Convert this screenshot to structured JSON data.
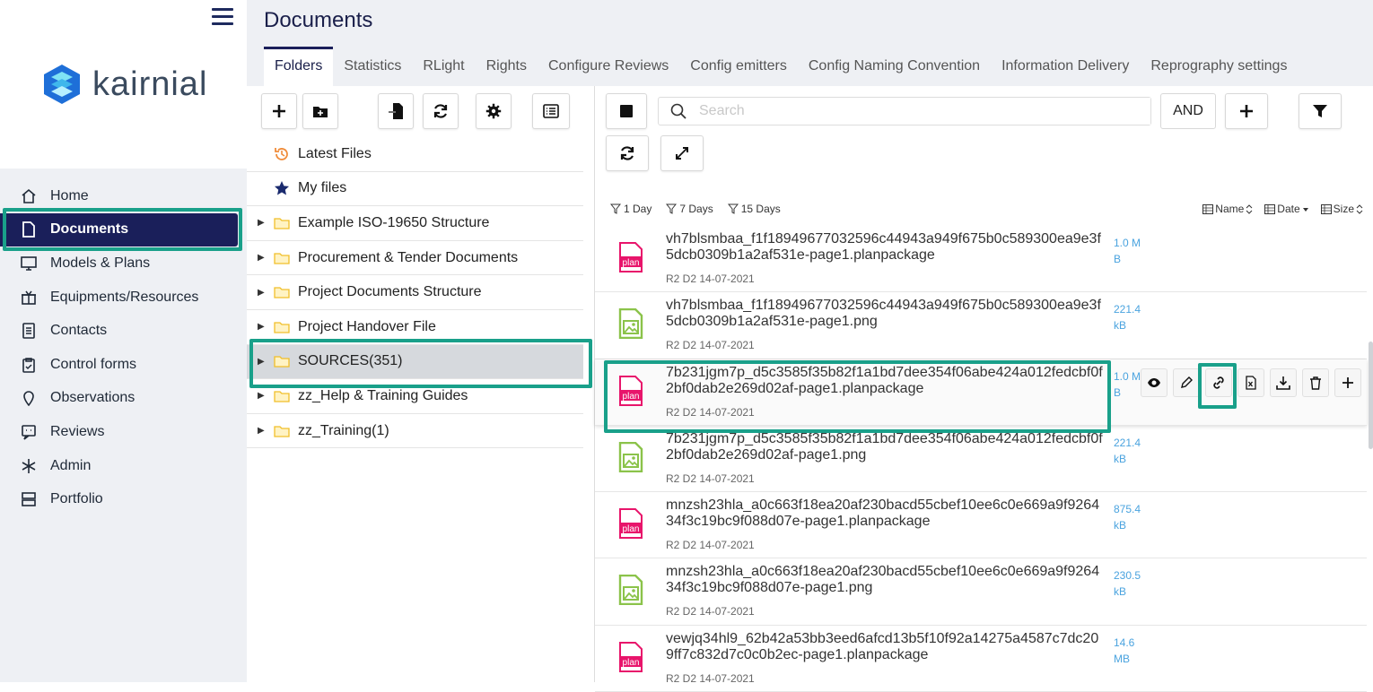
{
  "app": {
    "brand": "kairnial",
    "page_title": "Documents"
  },
  "nav": [
    {
      "label": "Home",
      "icon": "home-icon"
    },
    {
      "label": "Documents",
      "icon": "document-icon",
      "active": true
    },
    {
      "label": "Models & Plans",
      "icon": "monitor-icon"
    },
    {
      "label": "Equipments/Resources",
      "icon": "box-icon"
    },
    {
      "label": "Contacts",
      "icon": "contacts-icon"
    },
    {
      "label": "Control forms",
      "icon": "clipboard-check-icon"
    },
    {
      "label": "Observations",
      "icon": "map-pin-icon"
    },
    {
      "label": "Reviews",
      "icon": "review-icon"
    },
    {
      "label": "Admin",
      "icon": "asterisk-icon"
    },
    {
      "label": "Portfolio",
      "icon": "server-icon"
    }
  ],
  "tabs": [
    "Folders",
    "Statistics",
    "RLight",
    "Rights",
    "Configure Reviews",
    "Config emitters",
    "Config Naming Convention",
    "Information Delivery",
    "Reprography settings"
  ],
  "tree": [
    {
      "label": "Latest Files",
      "icon": "history-icon",
      "caret": false
    },
    {
      "label": "My files",
      "icon": "star-icon",
      "caret": false
    },
    {
      "label": "Example ISO-19650 Structure",
      "icon": "folder-icon",
      "caret": true
    },
    {
      "label": "Procurement & Tender Documents",
      "icon": "folder-icon",
      "caret": true
    },
    {
      "label": "Project Documents Structure",
      "icon": "folder-icon",
      "caret": true
    },
    {
      "label": "Project Handover File",
      "icon": "folder-icon",
      "caret": true
    },
    {
      "label": "SOURCES(351)",
      "icon": "folder-icon",
      "caret": true,
      "selected": true
    },
    {
      "label": "zz_Help & Training Guides",
      "icon": "folder-icon",
      "caret": true
    },
    {
      "label": "zz_Training(1)",
      "icon": "folder-icon",
      "caret": true
    }
  ],
  "search": {
    "placeholder": "Search",
    "operator": "AND"
  },
  "filters": [
    "1 Day",
    "7 Days",
    "15 Days"
  ],
  "sorts": [
    "Name",
    "Date",
    "Size"
  ],
  "files": [
    {
      "name": "vh7blsmbaa_f1f18949677032596c44943a949f675b0c589300ea9e3f5dcb0309b1a2af531e-page1.planpackage",
      "meta": "R2 D2 14-07-2021",
      "size": "1.0 MB",
      "type": "plan"
    },
    {
      "name": "vh7blsmbaa_f1f18949677032596c44943a949f675b0c589300ea9e3f5dcb0309b1a2af531e-page1.png",
      "meta": "R2 D2 14-07-2021",
      "size": "221.4 kB",
      "type": "image"
    },
    {
      "name": "7b231jgm7p_d5c3585f35b82f1a1bd7dee354f06abe424a012fedcbf0f2bf0dab2e269d02af-page1.planpackage",
      "meta": "R2 D2 14-07-2021",
      "size": "1.0 MB",
      "type": "plan",
      "hover": true
    },
    {
      "name": "7b231jgm7p_d5c3585f35b82f1a1bd7dee354f06abe424a012fedcbf0f2bf0dab2e269d02af-page1.png",
      "meta": "R2 D2 14-07-2021",
      "size": "221.4 kB",
      "type": "image"
    },
    {
      "name": "mnzsh23hla_a0c663f18ea20af230bacd55cbef10ee6c0e669a9f926434f3c19bc9f088d07e-page1.planpackage",
      "meta": "R2 D2 14-07-2021",
      "size": "875.4 kB",
      "type": "plan"
    },
    {
      "name": "mnzsh23hla_a0c663f18ea20af230bacd55cbef10ee6c0e669a9f926434f3c19bc9f088d07e-page1.png",
      "meta": "R2 D2 14-07-2021",
      "size": "230.5 kB",
      "type": "image"
    },
    {
      "name": "vewjq34hl9_62b42a53bb3eed6afcd13b5f10f92a14275a4587c7dc209ff7c832d7c0c0b2ec-page1.planpackage",
      "meta": "R2 D2 14-07-2021",
      "size": "14.6 MB",
      "type": "plan"
    }
  ],
  "file_icon_label": "plan",
  "row_actions": [
    "eye-icon",
    "pencil-icon",
    "link-icon",
    "excel-icon",
    "download-icon",
    "trash-icon",
    "plus-icon"
  ],
  "colors": {
    "nav_active": "#1a1f5a",
    "highlight": "#19a08a",
    "plan_icon": "#e8156b",
    "image_icon": "#8bc34a",
    "size_text": "#4aa3df"
  }
}
